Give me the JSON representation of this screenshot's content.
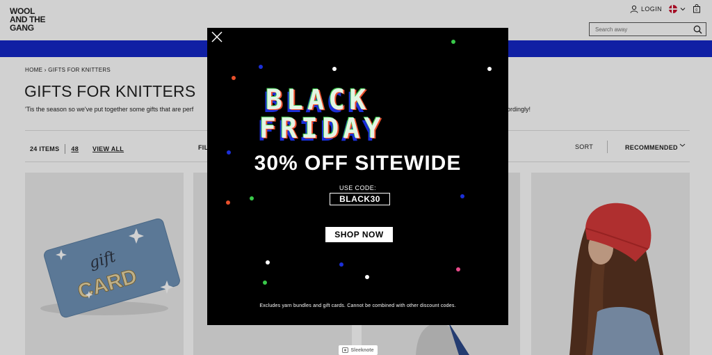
{
  "header": {
    "logo": "WOOL AND THE GANG",
    "nav": [
      "",
      "",
      "",
      "",
      ""
    ],
    "login_label": "LOGIN",
    "search_placeholder": "Search away"
  },
  "page": {
    "breadcrumb": "HOME › GIFTS FOR KNITTERS",
    "title": "GIFTS FOR KNITTERS",
    "intro_start": "'Tis the season so we've put together some gifts that are perf",
    "intro_end": "ordingly!",
    "items_count": "24 ITEMS",
    "per_page": "48",
    "view_all": "VIEW ALL",
    "filter_label": "FIL",
    "sort_label": "SORT",
    "sort_value": "RECOMMENDED"
  },
  "products": {
    "gift_card_text": "gift CARD"
  },
  "popup": {
    "headline": "30% OFF SITEWIDE",
    "use_code_label": "USE CODE:",
    "code": "BLACK30",
    "shop_button": "SHOP NOW",
    "disclaimer": "Excludes yarn bundles and gift cards. Cannot be combined with other discount codes.",
    "pixel_text_line1": "BLACK",
    "pixel_text_line2": "FRIDAY"
  },
  "sleeknote_label": "Sleeknote",
  "colors": {
    "accent_blue": "#1428c8",
    "popup_bg": "#000000",
    "beanie_red": "#d63a3a",
    "card_blue": "#6f93b8"
  }
}
